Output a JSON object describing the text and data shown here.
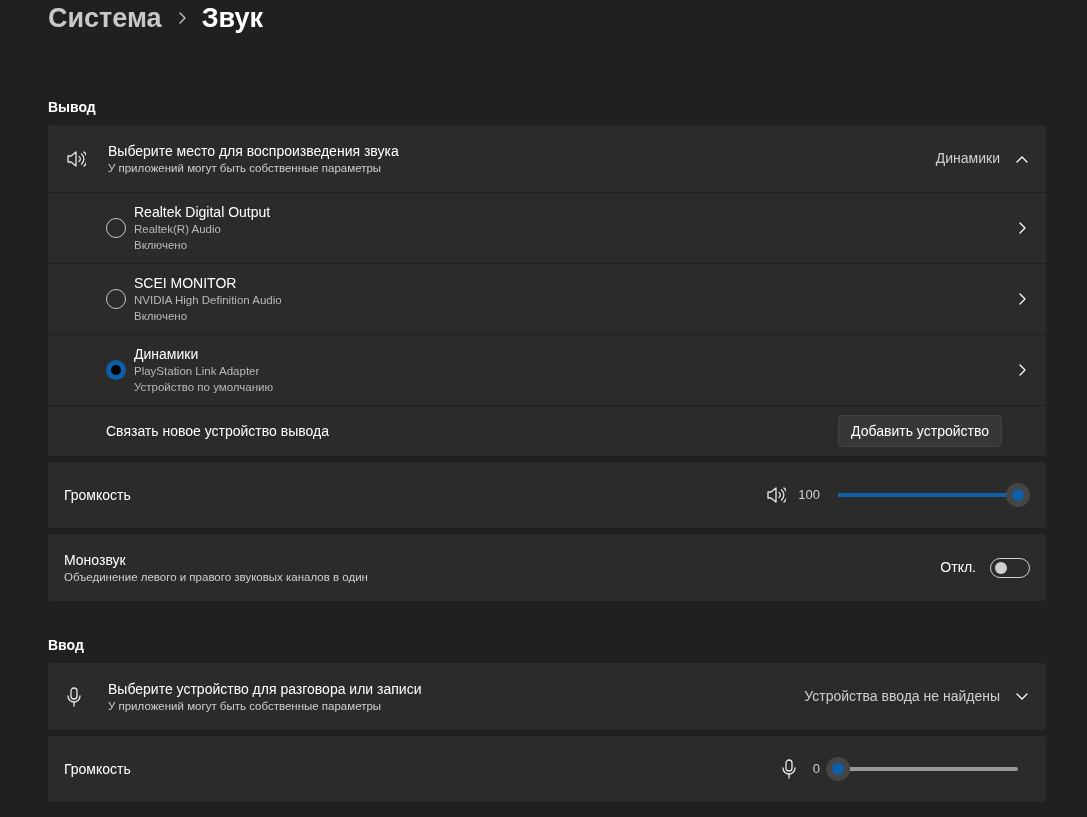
{
  "breadcrumb": {
    "parent": "Система",
    "current": "Звук"
  },
  "output": {
    "heading": "Вывод",
    "device_picker": {
      "title": "Выберите место для воспроизведения звука",
      "subtitle": "У приложений могут быть собственные параметры",
      "value": "Динамики",
      "expanded": true
    },
    "devices": [
      {
        "name": "Realtek Digital Output",
        "driver": "Realtek(R) Audio",
        "status": "Включено",
        "selected": false
      },
      {
        "name": "SCEI MONITOR",
        "driver": "NVIDIA High Definition Audio",
        "status": "Включено",
        "selected": false
      },
      {
        "name": "Динамики",
        "driver": "PlayStation Link Adapter",
        "status": "Устройство по умолчанию",
        "selected": true
      }
    ],
    "link": {
      "label": "Связать новое устройство вывода",
      "button": "Добавить устройство"
    },
    "volume": {
      "label": "Громкость",
      "reading": "100",
      "level": 1
    },
    "mono": {
      "title": "Монозвук",
      "subtitle": "Объединение левого и правого звуковых каналов в один",
      "state_label": "Откл.",
      "on": false
    }
  },
  "input": {
    "heading": "Ввод",
    "device_picker": {
      "title": "Выберите устройство для разговора или записи",
      "subtitle": "У приложений могут быть собственные параметры",
      "value": "Устройства ввода не найдены",
      "expanded": false
    },
    "volume": {
      "label": "Громкость",
      "reading": "0",
      "level": 0
    }
  }
}
